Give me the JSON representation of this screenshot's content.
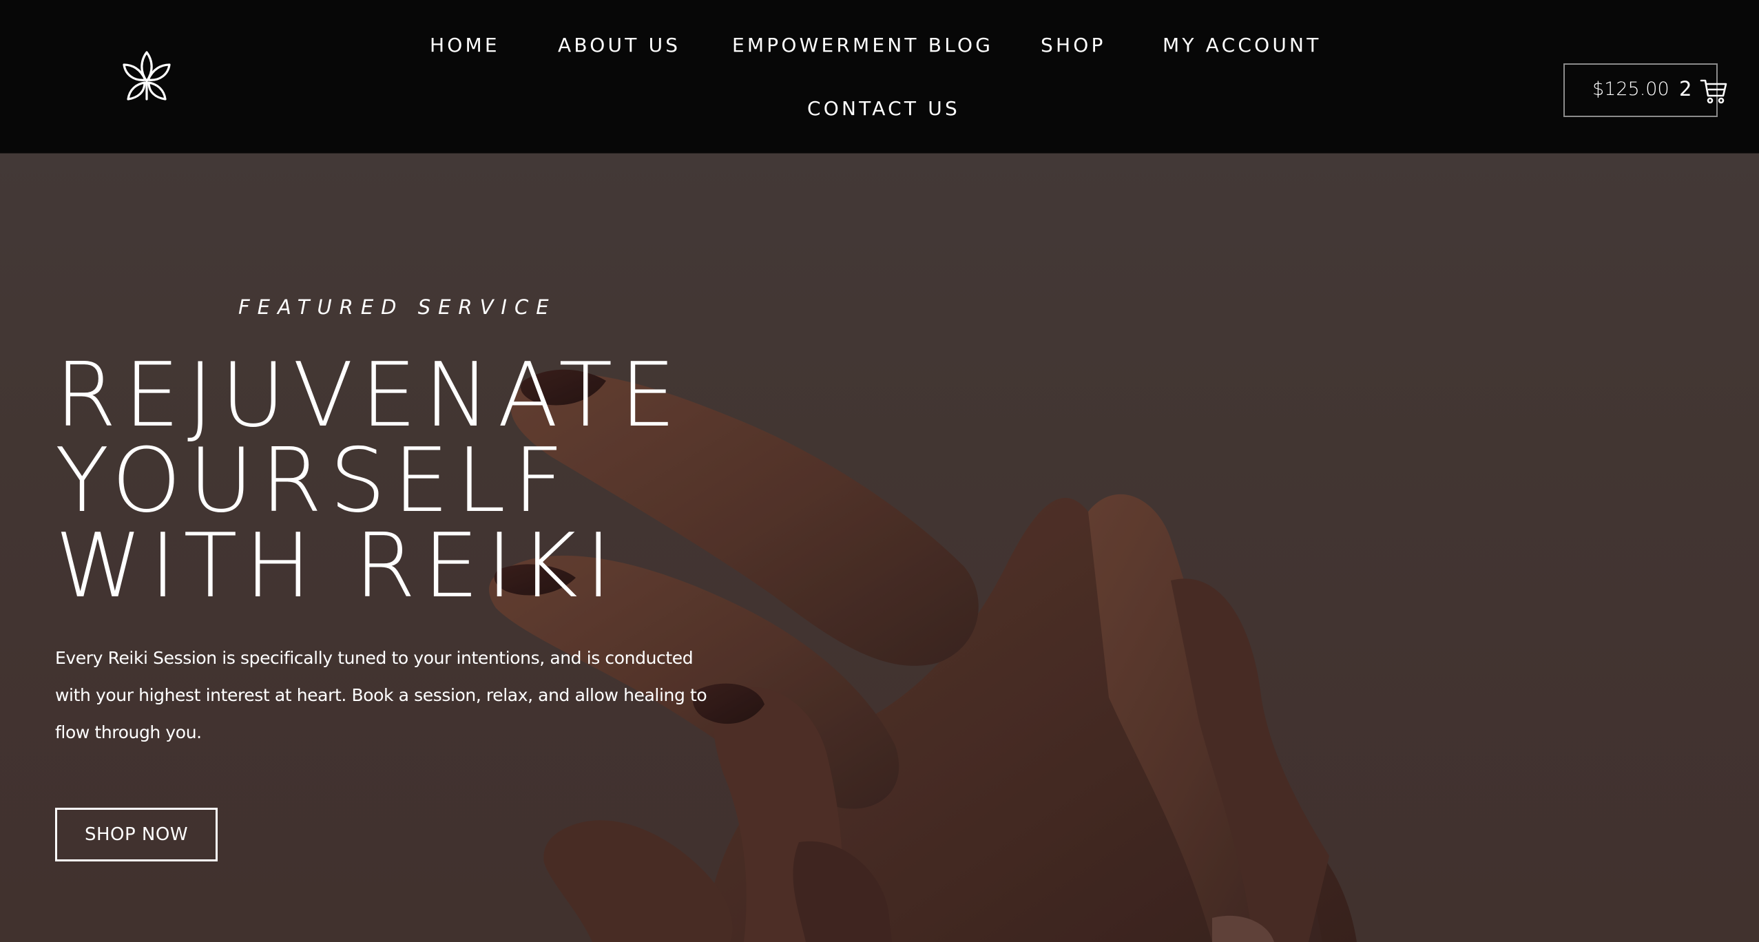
{
  "nav": {
    "items": [
      {
        "label": "HOME"
      },
      {
        "label": "ABOUT US"
      },
      {
        "label": "EMPOWERMENT BLOG"
      },
      {
        "label": "SHOP"
      },
      {
        "label": "MY ACCOUNT"
      },
      {
        "label": "CONTACT US"
      }
    ]
  },
  "cart": {
    "total": "$125.00",
    "count": "2",
    "icon": "shopping-cart-icon"
  },
  "logo": {
    "icon": "lotus-icon"
  },
  "hero": {
    "eyebrow": "FEATURED SERVICE",
    "headline_lines": [
      "REJUVENATE",
      "YOURSELF",
      "WITH REIKI"
    ],
    "body": "Every Reiki Session is specifically tuned to your intentions, and is conducted with your highest interest at heart. Book a session, relax, and allow healing to flow through you.",
    "cta_label": "SHOP NOW"
  },
  "colors": {
    "header_bg": "#070707",
    "hero_bg": "#473b37",
    "text": "#ffffff",
    "cart_border": "#8b8b8b"
  }
}
